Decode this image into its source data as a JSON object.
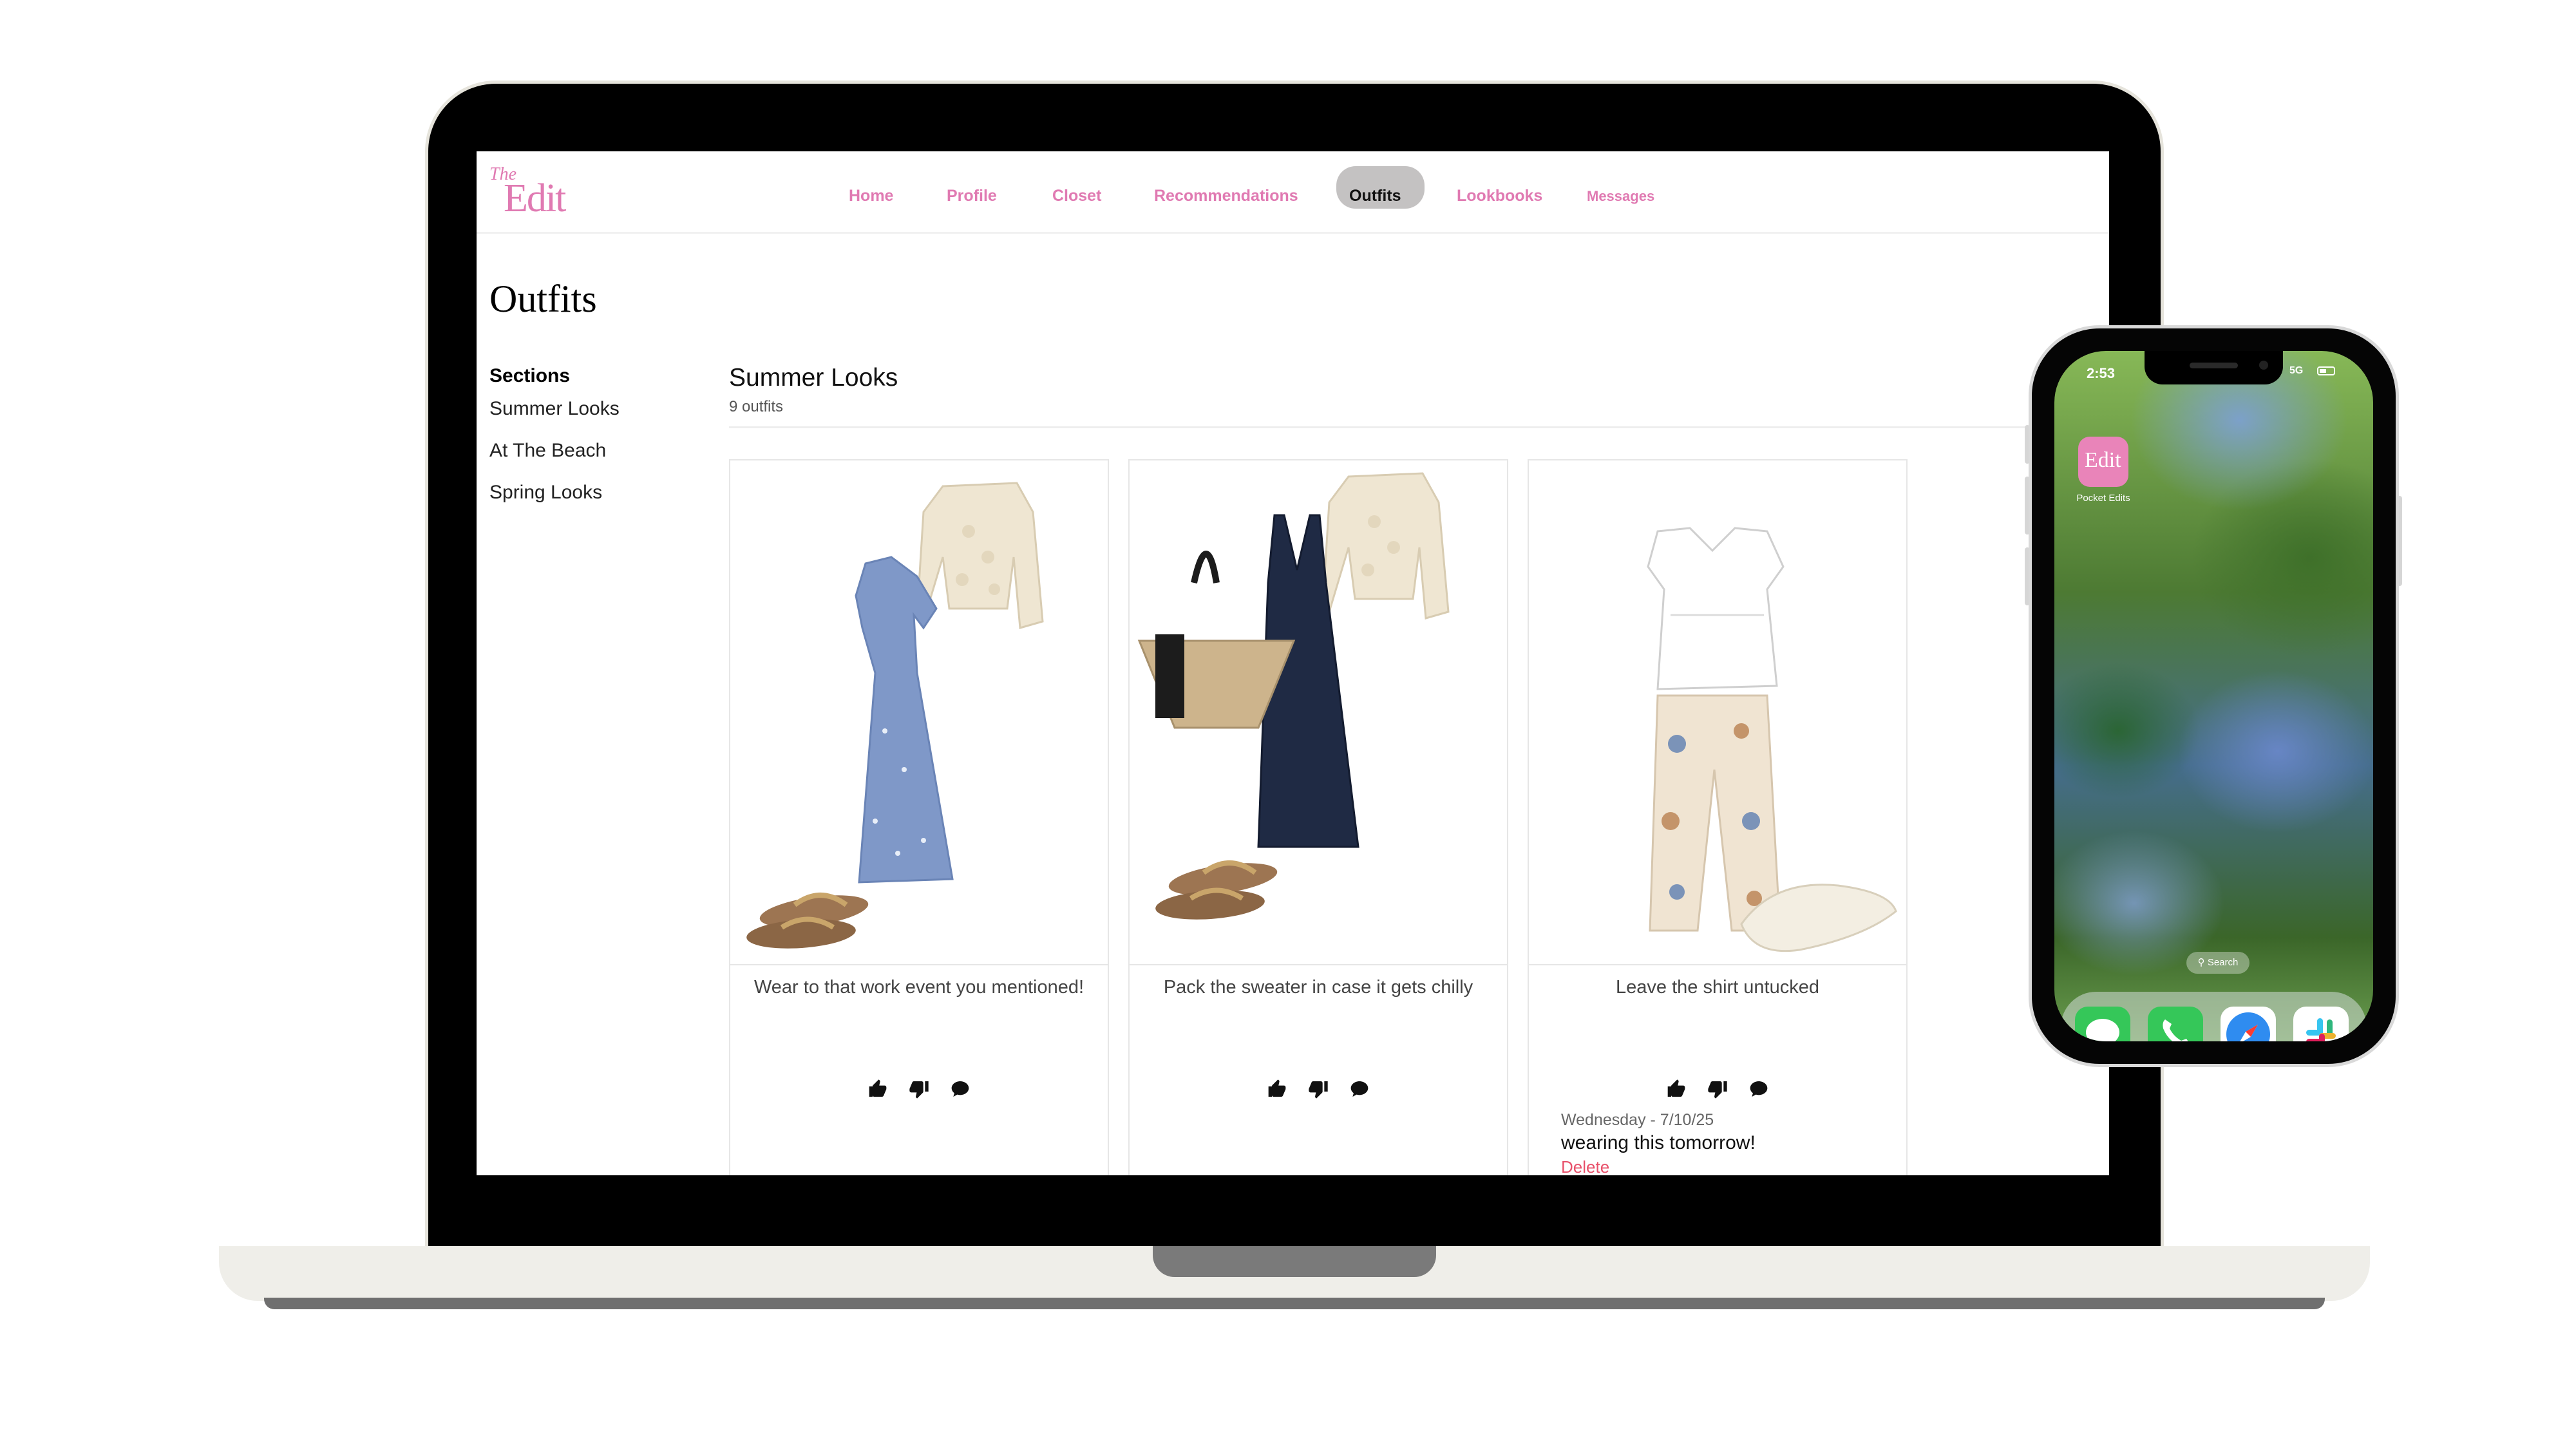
{
  "app": {
    "logo_text_small": "The",
    "logo_text_large": "Edit",
    "brand_color": "#e07ab2"
  },
  "nav": {
    "items": [
      {
        "label": "Home"
      },
      {
        "label": "Profile"
      },
      {
        "label": "Closet"
      },
      {
        "label": "Recommendations"
      },
      {
        "label": "Outfits",
        "active": true
      },
      {
        "label": "Lookbooks"
      },
      {
        "label": "Messages"
      }
    ]
  },
  "page": {
    "title": "Outfits"
  },
  "sidebar": {
    "heading": "Sections",
    "items": [
      {
        "label": "Summer Looks"
      },
      {
        "label": "At The Beach"
      },
      {
        "label": "Spring Looks"
      }
    ]
  },
  "collection": {
    "title": "Summer Looks",
    "count": "9 outfits"
  },
  "outfits": [
    {
      "caption": "Wear to that work event you mentioned!",
      "items": [
        "cream-cardigan-icon",
        "blue-floral-dress-icon",
        "brown-sandals-icon"
      ]
    },
    {
      "caption": "Pack the sweater in case it gets chilly",
      "items": [
        "cream-cardigan-icon",
        "straw-tote-bag-icon",
        "navy-slip-dress-icon",
        "brown-sandals-icon"
      ]
    },
    {
      "caption": "Leave the shirt untucked",
      "items": [
        "white-blouse-icon",
        "printed-trousers-icon",
        "cream-flats-icon"
      ],
      "comment": {
        "date": "Wednesday - 7/10/25",
        "text": "wearing this tomorrow!",
        "delete_label": "Delete"
      }
    }
  ],
  "actions": {
    "like": "thumbs-up-icon",
    "dislike": "thumbs-down-icon",
    "comment": "comment-icon"
  },
  "phone": {
    "time": "2:53",
    "network": "5G",
    "app_label": "Pocket Edits",
    "app_icon_text": "Edit",
    "search_label": "Search",
    "dock": [
      "messages-icon",
      "phone-icon",
      "safari-icon",
      "slack-icon"
    ]
  }
}
